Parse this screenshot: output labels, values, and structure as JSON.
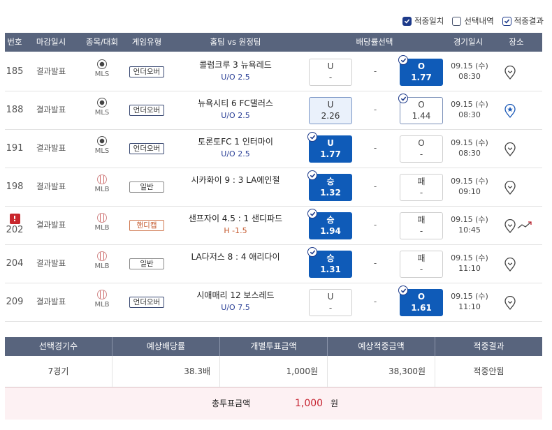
{
  "legend": [
    {
      "label": "적중일치",
      "state": "checked"
    },
    {
      "label": "선택내역",
      "state": "unchecked"
    },
    {
      "label": "적중결과",
      "state": "outlined"
    }
  ],
  "columns": {
    "num": "번호",
    "deadline": "마감일시",
    "sport": "종목/대회",
    "type": "게임유형",
    "match": "홈팀 vs 원정팀",
    "odds": "배당률선택",
    "time": "경기일시",
    "place": "장소"
  },
  "rows": [
    {
      "num": "185",
      "deadline": "결과발표",
      "sport": "soccer",
      "league": "MLS",
      "type": "언더오버",
      "type_style": "blue",
      "teams": "콜럼크루   3   뉴욕레드",
      "sub": "U/O 2.5",
      "sub_style": "blue",
      "opt1": {
        "label": "U",
        "value": "-",
        "style": "plain",
        "check": false
      },
      "mid": "-",
      "opt2": {
        "label": "O",
        "value": "1.77",
        "style": "sel",
        "check": true
      },
      "date": "09.15 (수)",
      "time": "08:30",
      "place_icon": "map-pin-icon",
      "trend": false
    },
    {
      "num": "188",
      "deadline": "결과발표",
      "sport": "soccer",
      "league": "MLS",
      "type": "언더오버",
      "type_style": "blue",
      "teams": "뉴욕시티   6   FC댈러스",
      "sub": "U/O 2.5",
      "sub_style": "blue",
      "opt1": {
        "label": "U",
        "value": "2.26",
        "style": "alt",
        "check": false
      },
      "mid": "-",
      "opt2": {
        "label": "O",
        "value": "1.44",
        "style": "out",
        "check": true
      },
      "date": "09.15 (수)",
      "time": "08:30",
      "place_icon": "star-pin-icon",
      "trend": false
    },
    {
      "num": "191",
      "deadline": "결과발표",
      "sport": "soccer",
      "league": "MLS",
      "type": "언더오버",
      "type_style": "blue",
      "teams": "토론토FC   1   인터마이",
      "sub": "U/O 2.5",
      "sub_style": "blue",
      "opt1": {
        "label": "U",
        "value": "1.77",
        "style": "sel",
        "check": true
      },
      "mid": "-",
      "opt2": {
        "label": "O",
        "value": "-",
        "style": "plain",
        "check": false
      },
      "date": "09.15 (수)",
      "time": "08:30",
      "place_icon": "map-pin-icon",
      "trend": false
    },
    {
      "num": "198",
      "deadline": "결과발표",
      "sport": "baseball",
      "league": "MLB",
      "type": "일반",
      "type_style": "gray",
      "teams": "시카화이 9 : 3 LA에인절",
      "sub": "",
      "sub_style": "blue",
      "opt1": {
        "label": "승",
        "value": "1.32",
        "style": "sel",
        "check": true
      },
      "mid": "-",
      "opt2": {
        "label": "패",
        "value": "-",
        "style": "plain",
        "check": false
      },
      "date": "09.15 (수)",
      "time": "09:10",
      "place_icon": "map-pin-icon",
      "trend": false
    },
    {
      "num": "202",
      "alert": "!",
      "deadline": "결과발표",
      "sport": "baseball",
      "league": "MLB",
      "type": "핸디캡",
      "type_style": "orange",
      "teams": "샌프자이 4.5 : 1 샌디파드",
      "sub": "H -1.5",
      "sub_style": "h",
      "opt1": {
        "label": "승",
        "value": "1.94",
        "style": "sel",
        "check": true
      },
      "mid": "-",
      "opt2": {
        "label": "패",
        "value": "-",
        "style": "plain",
        "check": false
      },
      "date": "09.15 (수)",
      "time": "10:45",
      "place_icon": "map-pin-icon",
      "trend": true
    },
    {
      "num": "204",
      "deadline": "결과발표",
      "sport": "baseball",
      "league": "MLB",
      "type": "일반",
      "type_style": "gray",
      "teams": "LA다저스 8 : 4 애리다이",
      "sub": "",
      "sub_style": "blue",
      "opt1": {
        "label": "승",
        "value": "1.31",
        "style": "sel",
        "check": true
      },
      "mid": "-",
      "opt2": {
        "label": "패",
        "value": "-",
        "style": "plain",
        "check": false
      },
      "date": "09.15 (수)",
      "time": "11:10",
      "place_icon": "map-pin-icon",
      "trend": false
    },
    {
      "num": "209",
      "deadline": "결과발표",
      "sport": "baseball",
      "league": "MLB",
      "type": "언더오버",
      "type_style": "blue",
      "teams": "시애매리   12   보스레드",
      "sub": "U/O 7.5",
      "sub_style": "blue",
      "opt1": {
        "label": "U",
        "value": "-",
        "style": "plain",
        "check": false
      },
      "mid": "-",
      "opt2": {
        "label": "O",
        "value": "1.61",
        "style": "sel",
        "check": true
      },
      "date": "09.15 (수)",
      "time": "11:10",
      "place_icon": "map-pin-icon",
      "trend": false
    }
  ],
  "summary": {
    "headers": [
      "선택경기수",
      "예상배당률",
      "개별투표금액",
      "예상적중금액",
      "적중결과"
    ],
    "values": [
      "7경기",
      "38.3배",
      "1,000원",
      "38,300원",
      "적중안됨"
    ]
  },
  "total": {
    "label": "총투표금액",
    "amount": "1,000",
    "unit": "원"
  },
  "colors": {
    "header_bg": "#58647d",
    "selected": "#0f5bb8",
    "accent_red": "#c62330"
  }
}
